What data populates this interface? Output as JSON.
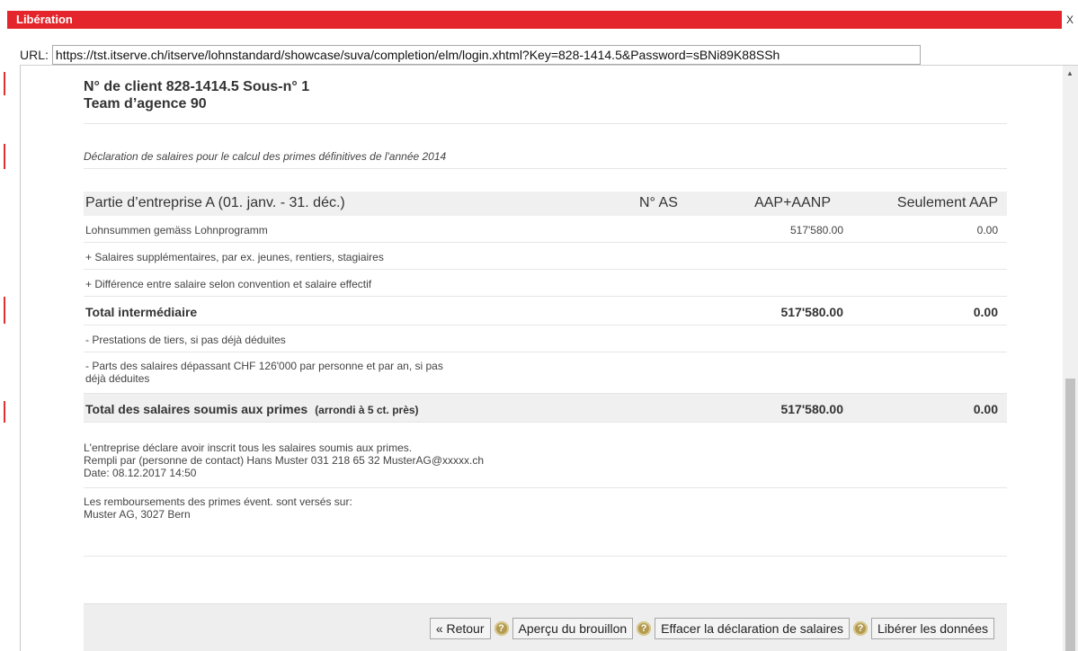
{
  "window": {
    "title": "Libération",
    "close_label": "X"
  },
  "urlbar": {
    "label": "URL:",
    "value": "https://tst.itserve.ch/itserve/lohnstandard/showcase/suva/completion/elm/login.xhtml?Key=828-1414.5&Password=sBNi89K88SSh"
  },
  "client": {
    "number_line": "N° de client 828-1414.5 Sous-n° 1",
    "team_line": "Team d’agence 90"
  },
  "declaration_title": "Déclaration de salaires pour le calcul des primes définitives de l'année 2014",
  "table": {
    "headers": {
      "part": "Partie d’entreprise A (01. janv. - 31. déc.)",
      "as": "N° AS",
      "aap_aanp": "AAP+AANP",
      "only_aap": "Seulement AAP"
    },
    "rows": [
      {
        "label": "Lohnsummen gemäss Lohnprogramm",
        "aap_aanp": "517'580.00",
        "only_aap": "0.00"
      },
      {
        "label": "+ Salaires supplémentaires, par ex. jeunes, rentiers, stagiaires",
        "aap_aanp": "",
        "only_aap": ""
      },
      {
        "label": "+ Différence entre salaire selon convention et salaire effectif",
        "aap_aanp": "",
        "only_aap": ""
      },
      {
        "label": "Total intermédiaire",
        "aap_aanp": "517'580.00",
        "only_aap": "0.00"
      },
      {
        "label": "- Prestations de tiers, si pas déjà déduites",
        "aap_aanp": "",
        "only_aap": ""
      },
      {
        "label_line1": "- Parts des salaires dépassant CHF 126'000 par personne et par an, si pas",
        "label_line2": "déjà déduites",
        "aap_aanp": "",
        "only_aap": ""
      }
    ],
    "total": {
      "label": "Total des salaires soumis aux primes",
      "note": "(arrondi à 5 ct. près)",
      "aap_aanp": "517'580.00",
      "only_aap": "0.00"
    }
  },
  "declaration_info": {
    "line1": "L'entreprise déclare avoir inscrit tous les salaires soumis aux primes.",
    "line2": "Rempli par (personne de contact) Hans Muster   031 218 65 32   MusterAG@xxxxx.ch",
    "line3": "Date: 08.12.2017 14:50"
  },
  "refund_info": {
    "line1": "Les remboursements des primes évent. sont versés sur:",
    "line2": "Muster AG, 3027 Bern"
  },
  "buttons": {
    "back": "« Retour",
    "preview": "Aperçu du brouillon",
    "delete": "Effacer la déclaration de salaires",
    "release": "Libérer les données",
    "help_glyph": "?"
  }
}
